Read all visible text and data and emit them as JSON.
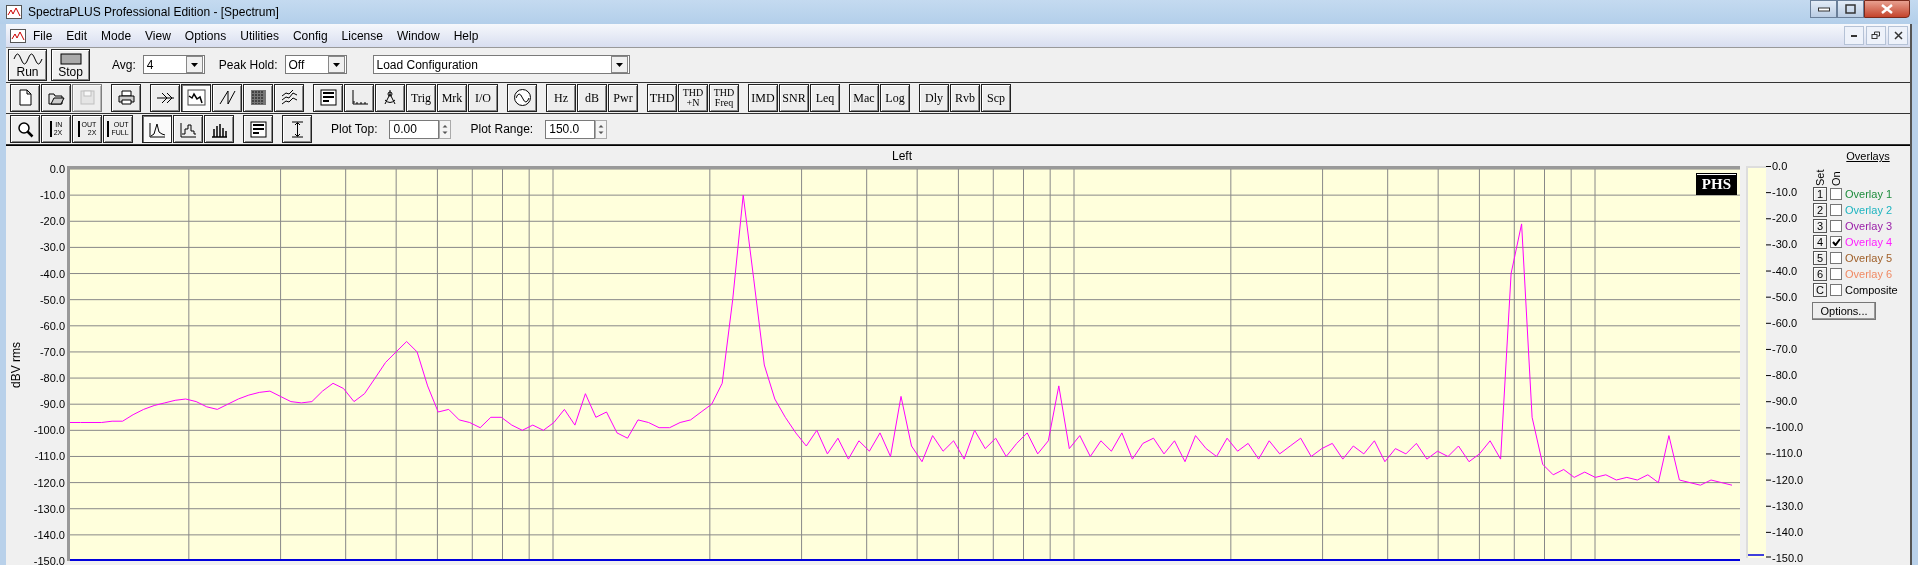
{
  "window": {
    "title": "SpectraPLUS Professional Edition - [Spectrum]"
  },
  "menu": [
    "File",
    "Edit",
    "Mode",
    "View",
    "Options",
    "Utilities",
    "Config",
    "License",
    "Window",
    "Help"
  ],
  "toolbar_main": {
    "run": "Run",
    "stop": "Stop",
    "avg": {
      "label": "Avg:",
      "value": "4"
    },
    "peak_hold": {
      "label": "Peak Hold:",
      "value": "Off"
    },
    "configuration": {
      "value": "Load Configuration"
    }
  },
  "toolbar_analysis": [
    [
      {
        "kind": "icon",
        "pressed": false,
        "disabled": false
      },
      {
        "kind": "icon",
        "pressed": false,
        "disabled": false
      },
      {
        "kind": "icon",
        "pressed": false,
        "disabled": true
      }
    ],
    [
      {
        "kind": "icon",
        "pressed": false,
        "disabled": false
      }
    ],
    [
      {
        "kind": "icon",
        "pressed": false,
        "disabled": false
      },
      {
        "kind": "icon",
        "pressed": true,
        "disabled": false
      },
      {
        "kind": "icon",
        "pressed": false,
        "disabled": false
      },
      {
        "kind": "icon",
        "pressed": false,
        "disabled": false
      },
      {
        "kind": "icon",
        "pressed": false,
        "disabled": false
      }
    ],
    [
      {
        "kind": "icon",
        "pressed": false,
        "disabled": false
      },
      {
        "kind": "icon",
        "pressed": false,
        "disabled": false
      },
      {
        "kind": "icon",
        "pressed": false,
        "disabled": false
      },
      {
        "kind": "text",
        "lines": [
          "Trig"
        ],
        "pressed": false,
        "disabled": false
      },
      {
        "kind": "text",
        "lines": [
          "Mrk"
        ],
        "pressed": false,
        "disabled": false
      },
      {
        "kind": "text",
        "lines": [
          "I/O"
        ],
        "pressed": false,
        "disabled": false
      }
    ],
    [
      {
        "kind": "icon",
        "pressed": false,
        "disabled": false
      }
    ],
    [
      {
        "kind": "text",
        "lines": [
          "Hz"
        ],
        "pressed": false,
        "disabled": false
      },
      {
        "kind": "text",
        "lines": [
          "dB"
        ],
        "pressed": false,
        "disabled": false
      },
      {
        "kind": "text",
        "lines": [
          "Pwr"
        ],
        "pressed": false,
        "disabled": false
      }
    ],
    [
      {
        "kind": "text",
        "lines": [
          "THD"
        ],
        "pressed": false,
        "disabled": false
      },
      {
        "kind": "text",
        "lines": [
          "THD",
          "+N"
        ],
        "pressed": false,
        "disabled": false
      },
      {
        "kind": "text",
        "lines": [
          "THD",
          "Freq"
        ],
        "pressed": false,
        "disabled": false
      }
    ],
    [
      {
        "kind": "text",
        "lines": [
          "IMD"
        ],
        "pressed": false,
        "disabled": false
      },
      {
        "kind": "text",
        "lines": [
          "SNR"
        ],
        "pressed": false,
        "disabled": false
      },
      {
        "kind": "text",
        "lines": [
          "Leq"
        ],
        "pressed": false,
        "disabled": false
      }
    ],
    [
      {
        "kind": "text",
        "lines": [
          "Mac"
        ],
        "pressed": false,
        "disabled": false
      },
      {
        "kind": "text",
        "lines": [
          "Log"
        ],
        "pressed": false,
        "disabled": false
      }
    ],
    [
      {
        "kind": "text",
        "lines": [
          "Dly"
        ],
        "pressed": false,
        "disabled": false
      },
      {
        "kind": "text",
        "lines": [
          "Rvb"
        ],
        "pressed": false,
        "disabled": false
      },
      {
        "kind": "text",
        "lines": [
          "Scp"
        ],
        "pressed": false,
        "disabled": false
      }
    ]
  ],
  "toolbar_plot": {
    "groups": [
      [
        {
          "kind": "icon",
          "pressed": false,
          "disabled": false
        },
        {
          "kind": "zoom",
          "lines": [
            "IN",
            "2X"
          ],
          "pressed": false,
          "disabled": false
        },
        {
          "kind": "zoom",
          "lines": [
            "OUT",
            "2X"
          ],
          "pressed": false,
          "disabled": false
        },
        {
          "kind": "zoom",
          "lines": [
            "OUT",
            "FULL"
          ],
          "pressed": false,
          "disabled": false
        }
      ],
      [
        {
          "kind": "icon",
          "pressed": true,
          "disabled": false
        },
        {
          "kind": "icon",
          "pressed": false,
          "disabled": false
        },
        {
          "kind": "icon",
          "pressed": false,
          "disabled": false
        }
      ],
      [
        {
          "kind": "icon",
          "pressed": false,
          "disabled": false
        }
      ],
      [
        {
          "kind": "icon",
          "pressed": false,
          "disabled": false
        }
      ]
    ],
    "plot_top": {
      "label": "Plot Top:",
      "value": "0.00"
    },
    "plot_range": {
      "label": "Plot Range:",
      "value": "150.0"
    }
  },
  "chart": {
    "logo": "PHS",
    "chart_data": {
      "type": "line",
      "ylabel": "dBV rms",
      "ylim": [
        -150,
        0
      ],
      "grid": true,
      "ref_lines": [
        {
          "axis": "y",
          "value": -150,
          "color": "#0000dd"
        }
      ],
      "yticks": [
        {
          "value": 0,
          "label": "0.0"
        },
        {
          "value": -10,
          "label": "-10.0"
        },
        {
          "value": -20,
          "label": "-20.0"
        },
        {
          "value": -30,
          "label": "-30.0"
        },
        {
          "value": -40,
          "label": "-40.0"
        },
        {
          "value": -50,
          "label": "-50.0"
        },
        {
          "value": -60,
          "label": "-60.0"
        },
        {
          "value": -70,
          "label": "-70.0"
        },
        {
          "value": -80,
          "label": "-80.0"
        },
        {
          "value": -90,
          "label": "-90.0"
        },
        {
          "value": -100,
          "label": "-100.0"
        },
        {
          "value": -110,
          "label": "-110.0"
        },
        {
          "value": -120,
          "label": "-120.0"
        },
        {
          "value": -130,
          "label": "-130.0"
        },
        {
          "value": -140,
          "label": "-140.0"
        },
        {
          "value": -150,
          "label": "-150.0"
        }
      ],
      "series": [
        {
          "name": "Left",
          "color": "#ff00ff",
          "values": [
            -97,
            -97,
            -97,
            -97,
            -96.5,
            -96.5,
            -94,
            -92,
            -90.5,
            -89.5,
            -88.5,
            -88,
            -89,
            -91,
            -92,
            -90,
            -88,
            -86.5,
            -85.5,
            -85,
            -87,
            -89,
            -89.5,
            -89,
            -85,
            -82,
            -84,
            -89,
            -86,
            -80,
            -74,
            -70,
            -66,
            -70,
            -83,
            -93,
            -92,
            -96,
            -97,
            -99,
            -95,
            -95,
            -98,
            -100,
            -98,
            -100,
            -97,
            -92,
            -98,
            -86,
            -95,
            -93,
            -101,
            -103,
            -96,
            -97,
            -99,
            -99,
            -97,
            -96,
            -93,
            -90,
            -82,
            -50,
            -10,
            -42,
            -75,
            -88,
            -95,
            -101,
            -106,
            -100,
            -109,
            -103,
            -111,
            -104,
            -108,
            -101,
            -110,
            -87,
            -106,
            -112,
            -102,
            -108,
            -104,
            -111,
            -100,
            -107,
            -103,
            -110,
            -105,
            -101,
            -109,
            -104,
            -83,
            -107,
            -102,
            -110,
            -104,
            -108,
            -101,
            -111,
            -105,
            -103,
            -109,
            -104,
            -112,
            -102,
            -107,
            -110,
            -103,
            -108,
            -105,
            -111,
            -104,
            -109,
            -106,
            -103,
            -110,
            -107,
            -105,
            -111,
            -106,
            -109,
            -104,
            -112,
            -107,
            -109,
            -105,
            -111,
            -108,
            -110,
            -106,
            -112,
            -109,
            -104,
            -111,
            -40,
            -21,
            -95,
            -113,
            -117,
            -115,
            -118,
            -116,
            -118,
            -117,
            -119,
            -118,
            -119,
            -117,
            -120,
            -102,
            -119,
            -120,
            -121,
            -119,
            -120,
            -121
          ]
        }
      ]
    },
    "scale_ticks": [
      "0.0",
      "-10.0",
      "-20.0",
      "-30.0",
      "-40.0",
      "-50.0",
      "-60.0",
      "-70.0",
      "-80.0",
      "-90.0",
      "-100.0",
      "-110.0",
      "-120.0",
      "-130.0",
      "-140.0",
      "-150.0"
    ]
  },
  "overlays": {
    "title": "Overlays",
    "set_header": "Set",
    "on_header": "On",
    "items": [
      {
        "set": "1",
        "label": "Overlay 1",
        "on": false,
        "color": "#1e8c3c"
      },
      {
        "set": "2",
        "label": "Overlay 2",
        "on": false,
        "color": "#1eb4c0"
      },
      {
        "set": "3",
        "label": "Overlay 3",
        "on": false,
        "color": "#9a1fa8"
      },
      {
        "set": "4",
        "label": "Overlay 4",
        "on": true,
        "color": "#ff1eff"
      },
      {
        "set": "5",
        "label": "Overlay 5",
        "on": false,
        "color": "#a0602a"
      },
      {
        "set": "6",
        "label": "Overlay 6",
        "on": false,
        "color": "#f08a64"
      },
      {
        "set": "C",
        "label": "Composite",
        "on": false,
        "color": "#000000"
      }
    ],
    "options_button": "Options..."
  }
}
